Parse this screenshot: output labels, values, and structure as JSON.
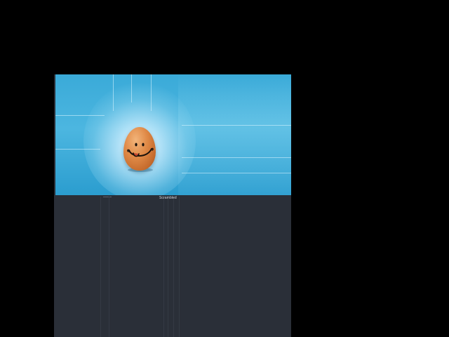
{
  "splash": {
    "image": "egg-mascot-icon",
    "background_color": "#3aaad8",
    "egg_color": "#e08a47"
  },
  "footer": {
    "label": "Scrambled",
    "background_color": "#2a2f38"
  }
}
